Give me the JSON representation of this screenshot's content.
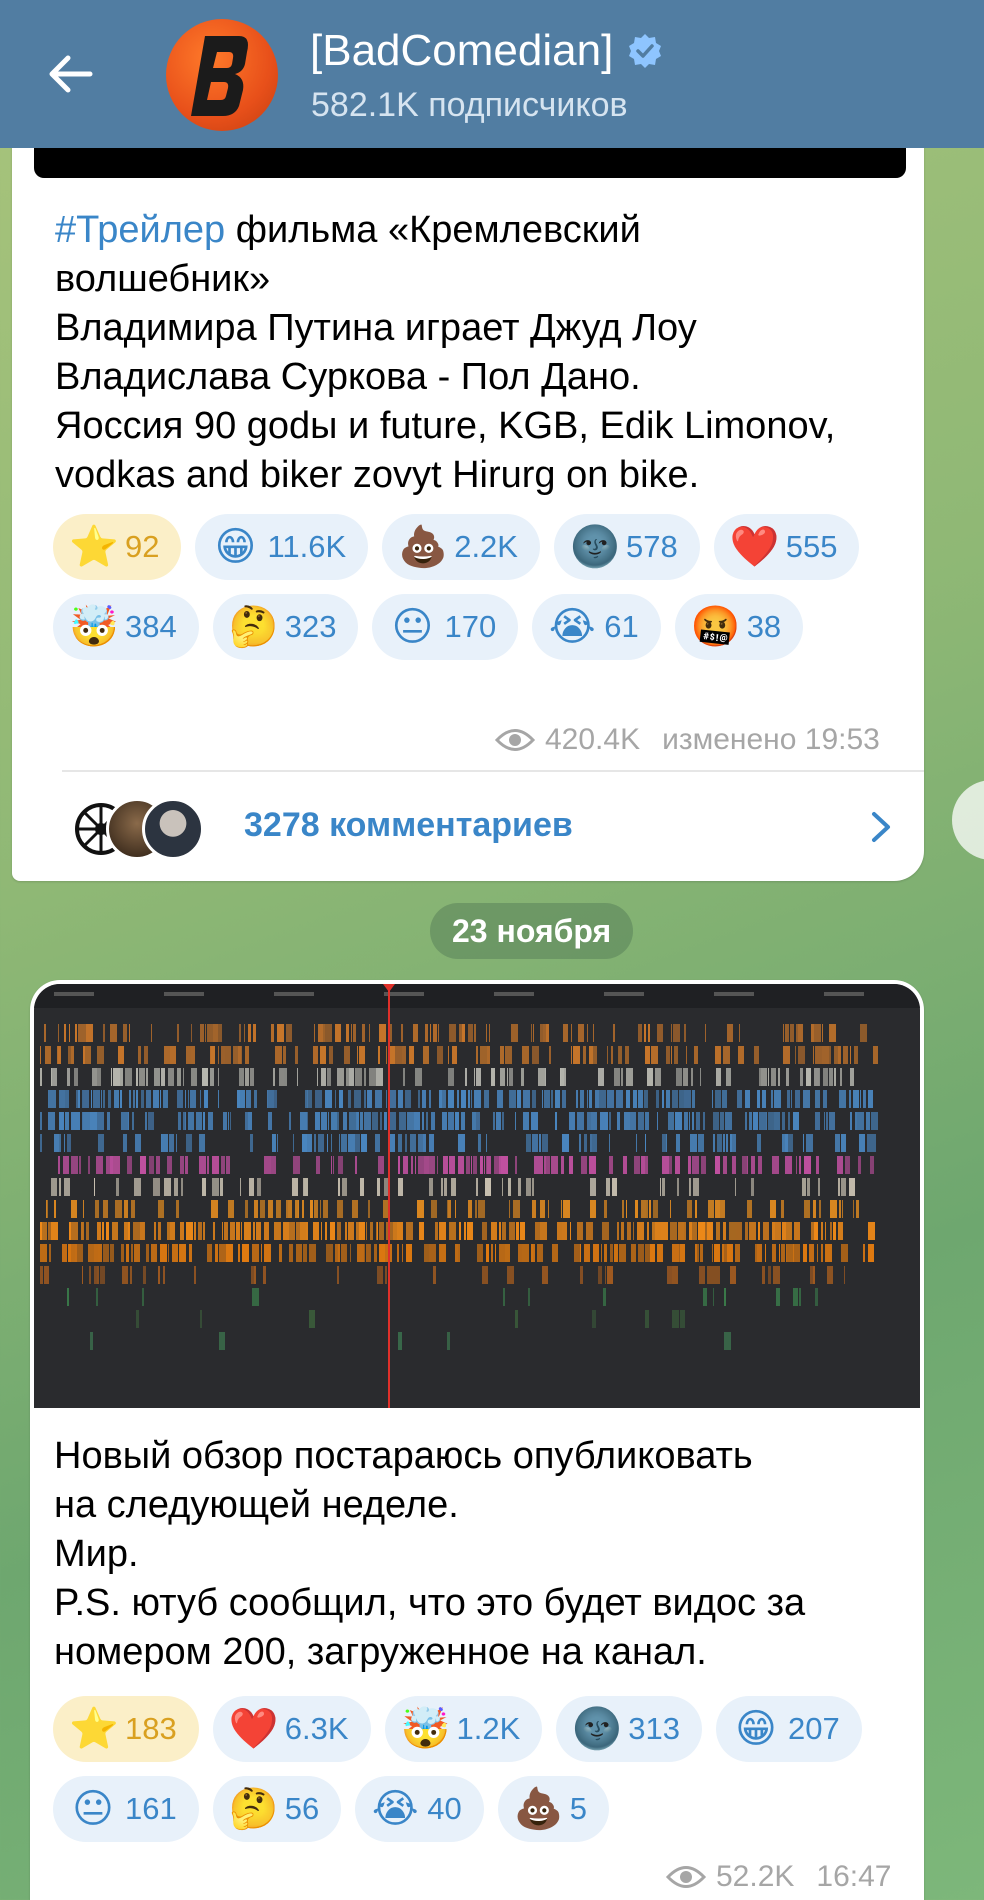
{
  "header": {
    "title": "[BadComedian]",
    "subscribers": "582.1K подписчиков",
    "colors": {
      "bar": "#517da2",
      "avatar": "#e8501a",
      "verified": "#8ec5ff"
    }
  },
  "post1": {
    "tag": "#Трейлер",
    "line1_rest": " фильма «Кремлевский",
    "line2": "волшебник»",
    "line3": "Владимира Путина играет Джуд Лоу",
    "line4": "Владислава Суркова - Пол Дано.",
    "line5": "Яоссия 90 godы и future, KGB, Edik Limonov,",
    "line6": "vodkas and biker zovyt Hirurg on bike.",
    "reactions": [
      {
        "emoji": "⭐",
        "count": "92",
        "starred": true
      },
      {
        "emoji": "😁",
        "count": "11.6K"
      },
      {
        "emoji": "💩",
        "count": "2.2K"
      },
      {
        "emoji": "🌚",
        "count": "578"
      },
      {
        "emoji": "❤️",
        "count": "555"
      },
      {
        "emoji": "🤯",
        "count": "384"
      },
      {
        "emoji": "🤔",
        "count": "323"
      },
      {
        "emoji": "😐",
        "count": "170"
      },
      {
        "emoji": "😭",
        "count": "61"
      },
      {
        "emoji": "🤬",
        "count": "38"
      }
    ],
    "views": "420.4K",
    "edited": "изменено 19:53",
    "comments": "3278 комментариев"
  },
  "date_separator": "23 ноября",
  "post2": {
    "line1": "Новый обзор постараюсь опубликовать",
    "line2": "на следующей неделе.",
    "line3": "Мир.",
    "line4": "P.S. ютуб сообщил, что это будет видос за",
    "line5": "номером 200, загруженное на канал.",
    "reactions": [
      {
        "emoji": "⭐",
        "count": "183",
        "starred": true
      },
      {
        "emoji": "❤️",
        "count": "6.3K"
      },
      {
        "emoji": "🤯",
        "count": "1.2K"
      },
      {
        "emoji": "🌚",
        "count": "313"
      },
      {
        "emoji": "😁",
        "count": "207"
      },
      {
        "emoji": "😐",
        "count": "161"
      },
      {
        "emoji": "🤔",
        "count": "56"
      },
      {
        "emoji": "😭",
        "count": "40"
      },
      {
        "emoji": "💩",
        "count": "5"
      }
    ],
    "views": "52.2K",
    "time": "16:47"
  }
}
